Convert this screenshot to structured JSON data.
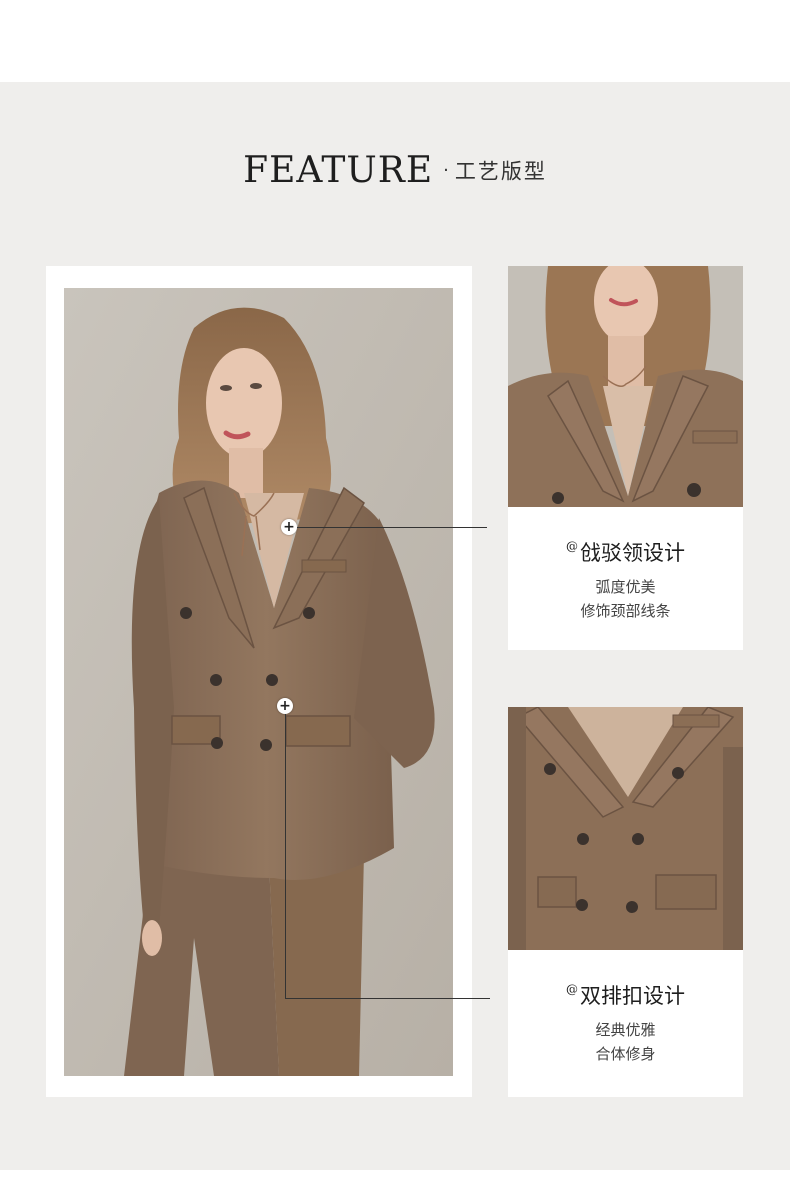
{
  "heading": {
    "english": "FEATURE",
    "separator": "·",
    "chinese": "工艺版型"
  },
  "features": [
    {
      "marker": "@",
      "title": "戗驳领设计",
      "lines": [
        "弧度优美",
        "修饰颈部线条"
      ]
    },
    {
      "marker": "@",
      "title": "双排扣设计",
      "lines": [
        "经典优雅",
        "合体修身"
      ]
    }
  ],
  "hotspots": [
    "+",
    "+"
  ],
  "colors": {
    "panel": "#efeeec",
    "suit": "#8b6e55",
    "frame": "#ffffff",
    "text": "#1e1e1e"
  }
}
